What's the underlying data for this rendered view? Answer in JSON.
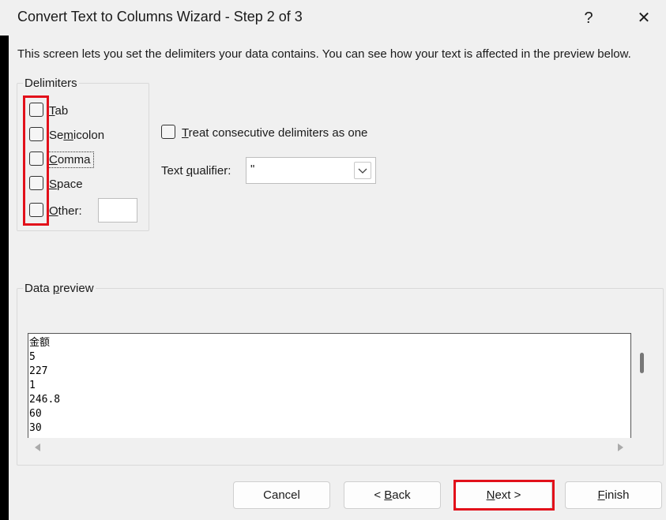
{
  "window": {
    "title": "Convert Text to Columns Wizard - Step 2 of 3",
    "help_label": "?",
    "close_label": "✕"
  },
  "instructions": "This screen lets you set the delimiters your data contains.  You can see how your text is affected in the preview below.",
  "delimiters": {
    "group_label": "Delimiters",
    "options": [
      {
        "label": "Tab",
        "mnemonic": "T",
        "checked": false
      },
      {
        "label": "Semicolon",
        "mnemonic": "m",
        "checked": false
      },
      {
        "label": "Comma",
        "mnemonic": "C",
        "checked": false
      },
      {
        "label": "Space",
        "mnemonic": "S",
        "checked": false
      },
      {
        "label": "Other:",
        "mnemonic": "O",
        "checked": false
      }
    ],
    "other_value": ""
  },
  "consecutive": {
    "label": "Treat consecutive delimiters as one",
    "checked": false
  },
  "qualifier": {
    "label": "Text qualifier:",
    "value": "\""
  },
  "preview": {
    "group_label": "Data preview",
    "lines": [
      "金额",
      "5",
      "227",
      "1",
      "246.8",
      "60",
      "30"
    ]
  },
  "buttons": {
    "cancel": "Cancel",
    "back": "< Back",
    "next": "Next >",
    "finish": "Finish"
  },
  "colors": {
    "highlight": "#e2101a",
    "background": "#f0f0f0"
  }
}
